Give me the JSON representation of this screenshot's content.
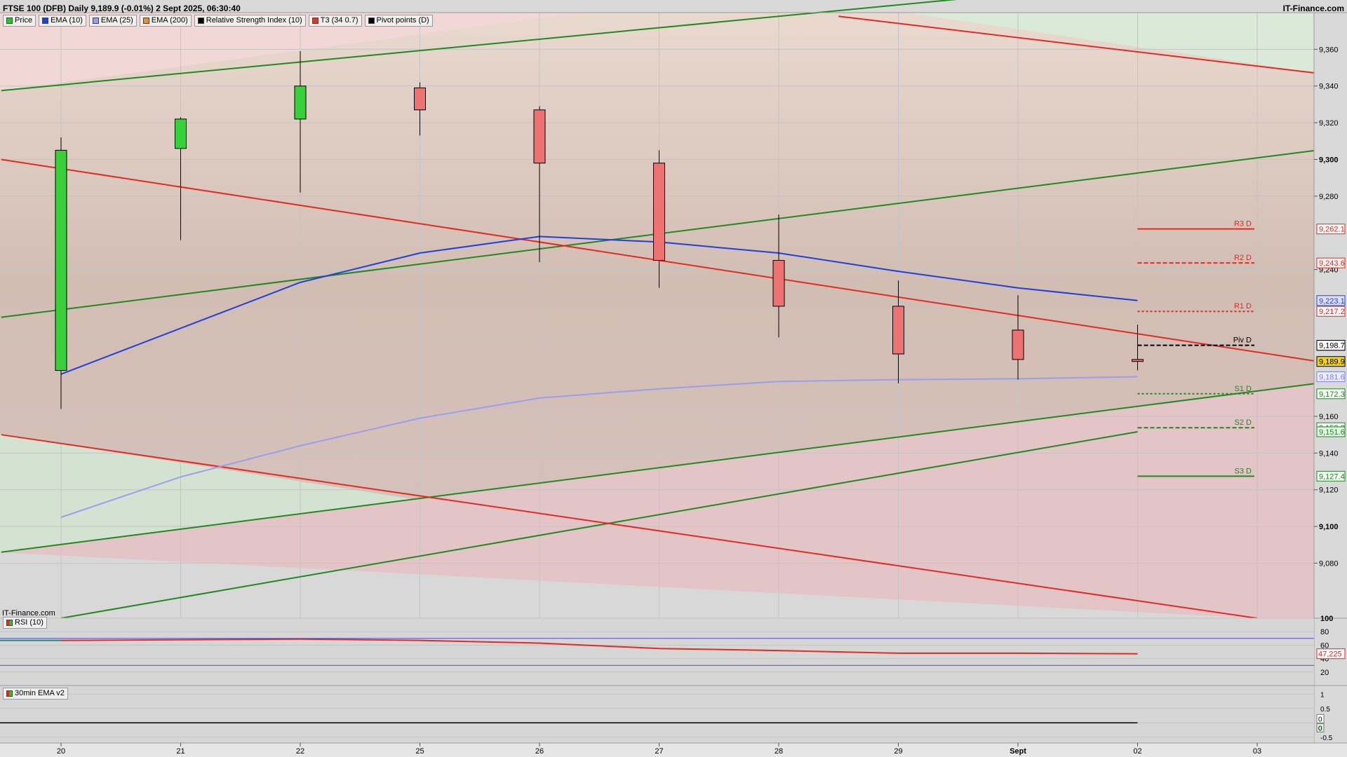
{
  "header": {
    "title": "FTSE 100 (DFB) Daily 9,189.9 (-0.01%) 2 Sept 2025, 06:30:40",
    "brand": "IT-Finance.com",
    "watermark": "IT-Finance.com"
  },
  "legend": [
    {
      "label": "Price",
      "color": "#2fbf2f"
    },
    {
      "label": "EMA (10)",
      "color": "#1f3fe0"
    },
    {
      "label": "EMA (25)",
      "color": "#9a9ef0"
    },
    {
      "label": "EMA (200)",
      "color": "#f08a2a"
    },
    {
      "label": "Relative Strength Index (10)",
      "color": "#000000"
    },
    {
      "label": "T3 (34 0.7)",
      "color": "#d93a2a"
    },
    {
      "label": "Pivot points (D)",
      "color": "#000000"
    }
  ],
  "panels": {
    "rsi_label": "RSI (10)",
    "ema_label": "30min EMA v2"
  },
  "colors": {
    "up": "#39d139",
    "down": "#ef7272",
    "ema10": "#1f3fe0",
    "ema25": "#9a9ef0",
    "trend_red": "#e42a22",
    "trend_green": "#1f8a1f",
    "pivot": "#000000",
    "rsi": "#e42a22",
    "current_price": "#f2d21a"
  },
  "chart_data": {
    "type": "candlestick",
    "x_labels": [
      "20",
      "21",
      "22",
      "25",
      "26",
      "27",
      "28",
      "29",
      "Sept",
      "02",
      "03"
    ],
    "y_ticks": [
      9080,
      9100,
      9120,
      9140,
      9160,
      9180,
      9200,
      9240,
      9280,
      9300,
      9320,
      9340,
      9360
    ],
    "y_tick_labels": [
      "9,080",
      "9,100",
      "9,120",
      "9,140",
      "9,160",
      "",
      "",
      "9,240",
      "9,280",
      "9,300",
      "9,320",
      "9,340",
      "9,360"
    ],
    "ylim": [
      9050,
      9380
    ],
    "candles": [
      {
        "x": "20",
        "open": 9185,
        "high": 9312,
        "low": 9164,
        "close": 9305
      },
      {
        "x": "21",
        "open": 9306,
        "high": 9323,
        "low": 9256,
        "close": 9322
      },
      {
        "x": "22",
        "open": 9322,
        "high": 9359,
        "low": 9282,
        "close": 9340
      },
      {
        "x": "25",
        "open": 9339,
        "high": 9342,
        "low": 9313,
        "close": 9327
      },
      {
        "x": "26",
        "open": 9327,
        "high": 9329,
        "low": 9244,
        "close": 9298
      },
      {
        "x": "27",
        "open": 9298,
        "high": 9305,
        "low": 9230,
        "close": 9245
      },
      {
        "x": "28",
        "open": 9245,
        "high": 9270,
        "low": 9203,
        "close": 9220
      },
      {
        "x": "29",
        "open": 9220,
        "high": 9234,
        "low": 9178,
        "close": 9194
      },
      {
        "x": "Sept",
        "open": 9207,
        "high": 9226,
        "low": 9180,
        "close": 9191
      },
      {
        "x": "02",
        "open": 9191,
        "high": 9210,
        "low": 9185,
        "close": 9189.9
      }
    ],
    "ema10": [
      {
        "x": "20",
        "y": 9183
      },
      {
        "x": "21",
        "y": 9208
      },
      {
        "x": "22",
        "y": 9233
      },
      {
        "x": "25",
        "y": 9249
      },
      {
        "x": "26",
        "y": 9258
      },
      {
        "x": "27",
        "y": 9255
      },
      {
        "x": "28",
        "y": 9249
      },
      {
        "x": "29",
        "y": 9239
      },
      {
        "x": "Sept",
        "y": 9230
      },
      {
        "x": "02",
        "y": 9223.1
      }
    ],
    "ema25": [
      {
        "x": "20",
        "y": 9105
      },
      {
        "x": "21",
        "y": 9127
      },
      {
        "x": "22",
        "y": 9144
      },
      {
        "x": "25",
        "y": 9159
      },
      {
        "x": "26",
        "y": 9170
      },
      {
        "x": "27",
        "y": 9175
      },
      {
        "x": "28",
        "y": 9179
      },
      {
        "x": "29",
        "y": 9180
      },
      {
        "x": "Sept",
        "y": 9180.5
      },
      {
        "x": "02",
        "y": 9181.6
      }
    ],
    "pivots": [
      {
        "label": "R3 D",
        "value": 9262.1,
        "value_label": "9,262.1",
        "style": "solid",
        "color": "#e42a22"
      },
      {
        "label": "R2 D",
        "value": 9243.6,
        "value_label": "9,243.6",
        "style": "dashed",
        "color": "#e42a22"
      },
      {
        "label": "R1 D",
        "value": 9217.2,
        "value_label": "9,217.2",
        "style": "dotted",
        "color": "#e42a22"
      },
      {
        "label": "Piv D",
        "value": 9198.7,
        "value_label": "9,198.7",
        "style": "dashed",
        "color": "#000000"
      },
      {
        "label": "S1 D",
        "value": 9172.3,
        "value_label": "9,172.3",
        "style": "dotted",
        "color": "#1f8a1f"
      },
      {
        "label": "S2 D",
        "value": 9153.8,
        "value_label": "9,153.8",
        "style": "dashed",
        "color": "#1f8a1f"
      },
      {
        "label": "S3 D",
        "value": 9127.4,
        "value_label": "9,127.4",
        "style": "solid",
        "color": "#1f8a1f"
      }
    ],
    "price_labels": [
      {
        "text": "9,223.1",
        "value": 9223.1,
        "color": "#1f3fe0",
        "bg": "#dfe0ff"
      },
      {
        "text": "9,198.7",
        "value": 9198.7,
        "color": "#000000",
        "bg": "#ffffff"
      },
      {
        "text": "9,189.9",
        "value": 9189.9,
        "color": "#000000",
        "bg": "#f2d21a"
      },
      {
        "text": "9,181.6",
        "value": 9181.6,
        "color": "#7c80e0",
        "bg": "#eceeff"
      },
      {
        "text": "9,151.6",
        "value": 9151.6,
        "color": "#1f8a1f",
        "bg": "#e4f4e4"
      }
    ],
    "trend_lines": [
      {
        "color": "#1f8a1f",
        "from": {
          "x": -0.5,
          "y": 9337.5
        },
        "to": {
          "x": 10.5,
          "y": 9406
        }
      },
      {
        "color": "#1f8a1f",
        "from": {
          "x": -0.5,
          "y": 9214
        },
        "to": {
          "x": 10.5,
          "y": 9305
        }
      },
      {
        "color": "#1f8a1f",
        "from": {
          "x": -0.5,
          "y": 9086
        },
        "to": {
          "x": 10.5,
          "y": 9178
        }
      },
      {
        "color": "#1f8a1f",
        "from": {
          "x": 0,
          "y": 9050
        },
        "to": {
          "x": 9,
          "y": 9151.6
        }
      },
      {
        "color": "#e42a22",
        "from": {
          "x": 6.5,
          "y": 9378
        },
        "to": {
          "x": 10.5,
          "y": 9347
        }
      },
      {
        "color": "#e42a22",
        "from": {
          "x": -0.5,
          "y": 9300
        },
        "to": {
          "x": 10.5,
          "y": 9190
        }
      },
      {
        "color": "#e42a22",
        "from": {
          "x": -0.5,
          "y": 9150
        },
        "to": {
          "x": 10,
          "y": 9050
        }
      }
    ],
    "rsi": {
      "ticks": [
        100,
        80,
        60,
        40,
        20
      ],
      "tick_labels": [
        "100",
        "80",
        "60",
        "40",
        "20"
      ],
      "levels": [
        70,
        30
      ],
      "value_label": "47,225",
      "values": [
        {
          "x": "20",
          "y": 67
        },
        {
          "x": "21",
          "y": 68
        },
        {
          "x": "22",
          "y": 69
        },
        {
          "x": "25",
          "y": 67
        },
        {
          "x": "26",
          "y": 63
        },
        {
          "x": "27",
          "y": 55
        },
        {
          "x": "28",
          "y": 52
        },
        {
          "x": "29",
          "y": 48
        },
        {
          "x": "Sept",
          "y": 48
        },
        {
          "x": "02",
          "y": 47.2
        }
      ]
    },
    "ema_panel": {
      "ticks": [
        1,
        0.5,
        0,
        -0.5
      ],
      "tick_labels": [
        "1",
        "0.5",
        "0",
        "-0.5"
      ],
      "value_labels": [
        "0",
        "0"
      ],
      "value": 0
    }
  }
}
